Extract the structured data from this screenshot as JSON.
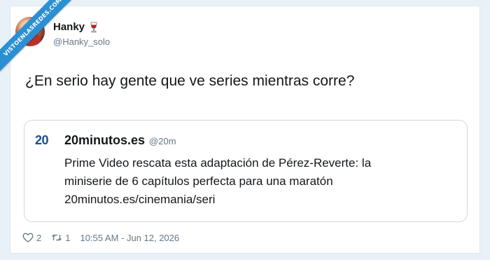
{
  "watermark": {
    "text": "VISTOENLASREDES.COM"
  },
  "author": {
    "display_name": "Hanky",
    "emoji_icon": "wine-glass-icon",
    "handle": "@Hanky_solo"
  },
  "tweet": {
    "text": "¿En serio hay gente que ve series mientras corre?"
  },
  "quoted": {
    "logo_text": "20",
    "name": "20minutos.es",
    "handle": "@20m",
    "lines": [
      "Prime Video rescata esta adaptación de Pérez-Reverte: la",
      "miniserie de 6 capítulos perfecta para una maratón",
      "20minutos.es/cinemania/seri"
    ]
  },
  "footer": {
    "likes": "2",
    "retweets": "1",
    "timestamp": "10:55 AM - Jun 12, 2026"
  },
  "colors": {
    "ribbon": "#2b8fd3",
    "text_secondary": "#657786",
    "logo": "#1d4e8f"
  }
}
